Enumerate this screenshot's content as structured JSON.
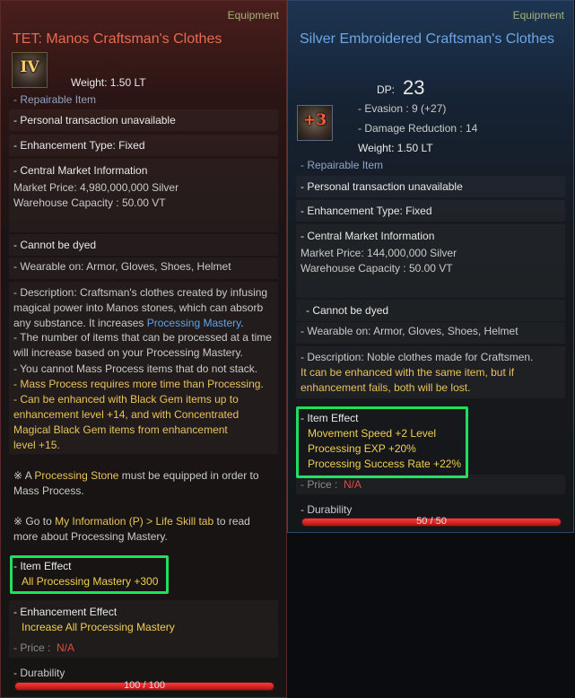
{
  "left": {
    "category": "Equipment",
    "title": "TET: Manos Craftsman's Clothes",
    "icon_label": "IV",
    "weight": "Weight:  1.50 LT",
    "repairable": "- Repairable Item",
    "transaction": "- Personal transaction unavailable",
    "enh_type": "- Enhancement Type: Fixed",
    "market_header": "- Central Market Information",
    "market_price": "Market Price: 4,980,000,000 Silver",
    "warehouse": "Warehouse Capacity : 50.00 VT",
    "cannot_dye": "- Cannot be dyed",
    "wearable": "- Wearable on: Armor, Gloves, Shoes, Helmet",
    "desc_1": "- Description: Craftsman's clothes created by infusing magical power into Manos stones, which can absorb any substance. It increases ",
    "desc_1_link": "Processing Mastery",
    "desc_1_end": ".",
    "desc_2": "- The number of items that can be processed at a time will increase based on your Processing Mastery.",
    "desc_3": "- You cannot Mass Process items that do not stack.",
    "desc_4": "- Mass Process requires more time than Processing.",
    "desc_5": "- Can be enhanced with Black Gem items up to enhancement level +14, and with Concentrated Magical Black Gem items from enhancement level +15.",
    "note_1_pre": "※ A ",
    "note_1_link": "Processing Stone",
    "note_1_post": " must be equipped in order to Mass Process.",
    "note_2_pre": "※ Go to ",
    "note_2_link": "My Information (P) > Life Skill tab",
    "note_2_post": " to read more about Processing Mastery.",
    "item_effect_header": "- Item Effect",
    "item_effect_1": "All Processing Mastery +300",
    "enh_effect_header": "- Enhancement Effect",
    "enh_effect_1": "Increase All Processing Mastery",
    "price_label": "- Price :",
    "price_value": "N/A",
    "durability_label": "- Durability",
    "durability_text": "100 / 100",
    "durability_fraction": 1.0
  },
  "right": {
    "category": "Equipment",
    "title": "Silver Embroidered Craftsman's Clothes",
    "icon_label": "+3",
    "dp_label": "DP:",
    "dp_value": "23",
    "evasion": "- Evasion :  9 (+27)",
    "damage_reduction": "- Damage Reduction :   14",
    "weight": "Weight:  1.50 LT",
    "repairable": "- Repairable Item",
    "transaction": "- Personal transaction unavailable",
    "enh_type": "- Enhancement Type: Fixed",
    "market_header": "- Central Market Information",
    "market_price": "Market Price: 144,000,000 Silver",
    "warehouse": "Warehouse Capacity : 50.00 VT",
    "cannot_dye": "- Cannot be dyed",
    "wearable": "- Wearable on: Armor, Gloves, Shoes, Helmet",
    "desc_1": "- Description: Noble clothes made for Craftsmen.",
    "desc_2": "It can be enhanced with the same item, but if enhancement fails, both will be lost.",
    "item_effect_header": "- Item Effect",
    "item_effect_1": "Movement Speed +2 Level",
    "item_effect_2": "Processing EXP +20%",
    "item_effect_3": "Processing Success Rate +22%",
    "price_label": "- Price :",
    "price_value": "N/A",
    "durability_label": "- Durability",
    "durability_text": "50 / 50",
    "durability_fraction": 1.0
  }
}
